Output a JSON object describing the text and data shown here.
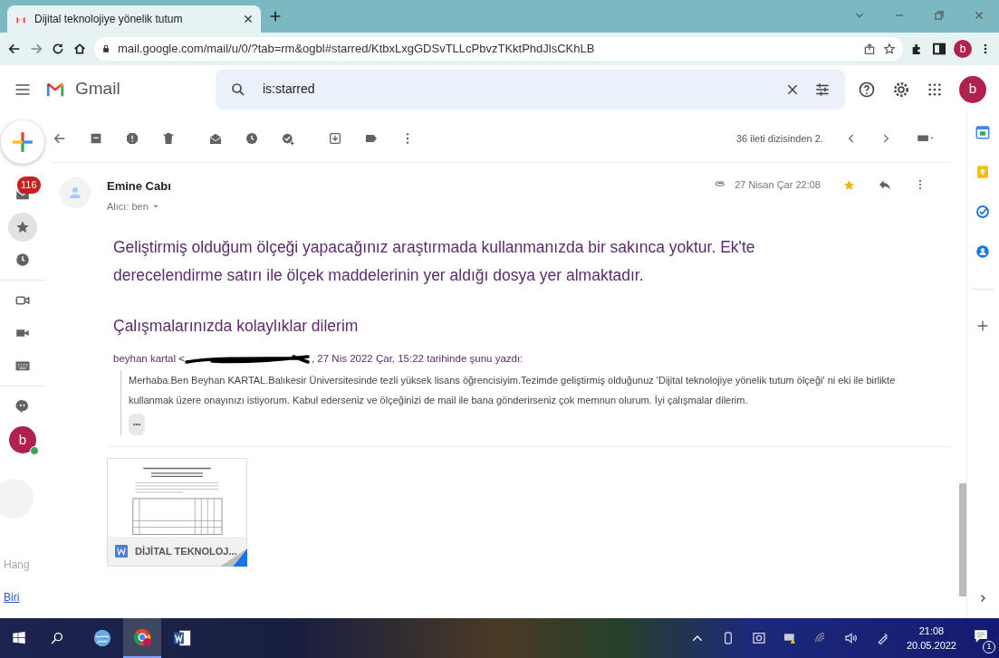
{
  "browser": {
    "tabs": [
      {
        "title": "Dijital teknolojiye yönelik tutum",
        "selected": true
      }
    ],
    "url": "mail.google.com/mail/u/0/?tab=rm&ogbl#starred/KtbxLxgGDSvTLLcPbvzTKktPhdJlsCKhLB",
    "profile_initial": "b"
  },
  "gmail": {
    "app_name": "Gmail",
    "search": {
      "value": "is:starred"
    },
    "avatar_initial": "b"
  },
  "toolbar": {
    "pagination": "36 ileti dizisinden 2."
  },
  "rail": {
    "sections": [
      {
        "items": [
          {
            "kind": "mail",
            "badge": "116",
            "selected": false
          },
          {
            "kind": "starred",
            "selected": true
          },
          {
            "kind": "snoozed",
            "selected": false
          }
        ]
      },
      {
        "items": [
          {
            "kind": "meet-new",
            "selected": false
          },
          {
            "kind": "meet-join",
            "selected": false
          },
          {
            "kind": "keyboard",
            "selected": false
          }
        ]
      },
      {
        "items": [
          {
            "kind": "chat",
            "selected": false
          },
          {
            "kind": "avatar",
            "initial": "b",
            "online": true,
            "selected": false
          }
        ]
      }
    ],
    "hangouts_texts": [
      {
        "kind": "text",
        "text": "Hang"
      },
      {
        "kind": "link",
        "text": "Biri"
      }
    ]
  },
  "message": {
    "sender": "Emine Cabı",
    "recipient": "Alıcı: ben",
    "date": "27 Nisan Çar 22:08",
    "has_attachment": true,
    "starred": true,
    "body": [
      "Geliştirmiş olduğum ölçeği yapacağınız araştırmada kullanmanızda bir sakınca yoktur. Ek'te derecelendirme satırı ile ölçek maddelerinin yer aldığı dosya yer almaktadır.",
      "Çalışmalarınızda kolaylıklar dilerim"
    ],
    "quote": {
      "header_before": "beyhan kartal <",
      "header_after": ", 27 Nis 2022 Çar, 15:22 tarihinde şunu yazdı:",
      "text": "Merhaba.Ben Beyhan KARTAL.Balıkesir Üniversitesinde tezli yüksek lisans öğrencisiyim.Tezimde geliştirmiş olduğunuz 'Dijital teknolojiye yönelik tutum ölçeği' ni eki ile birlikte kullanmak üzere onayınızı istiyorum. Kabul ederseniz ve ölçeğinizi de mail ile bana gönderirseniz çok memnun olurum. İyi çalışmalar dilerim.",
      "more": "•••"
    },
    "attachment": {
      "name": "DİJİTAL TEKNOLOJ..."
    }
  },
  "taskbar": {
    "apps": [
      {
        "kind": "browser-globe",
        "selected": false
      },
      {
        "kind": "chrome",
        "selected": true
      },
      {
        "kind": "word",
        "selected": false
      }
    ],
    "time": "21:08",
    "date": "20.05.2022",
    "notifications": "1"
  }
}
